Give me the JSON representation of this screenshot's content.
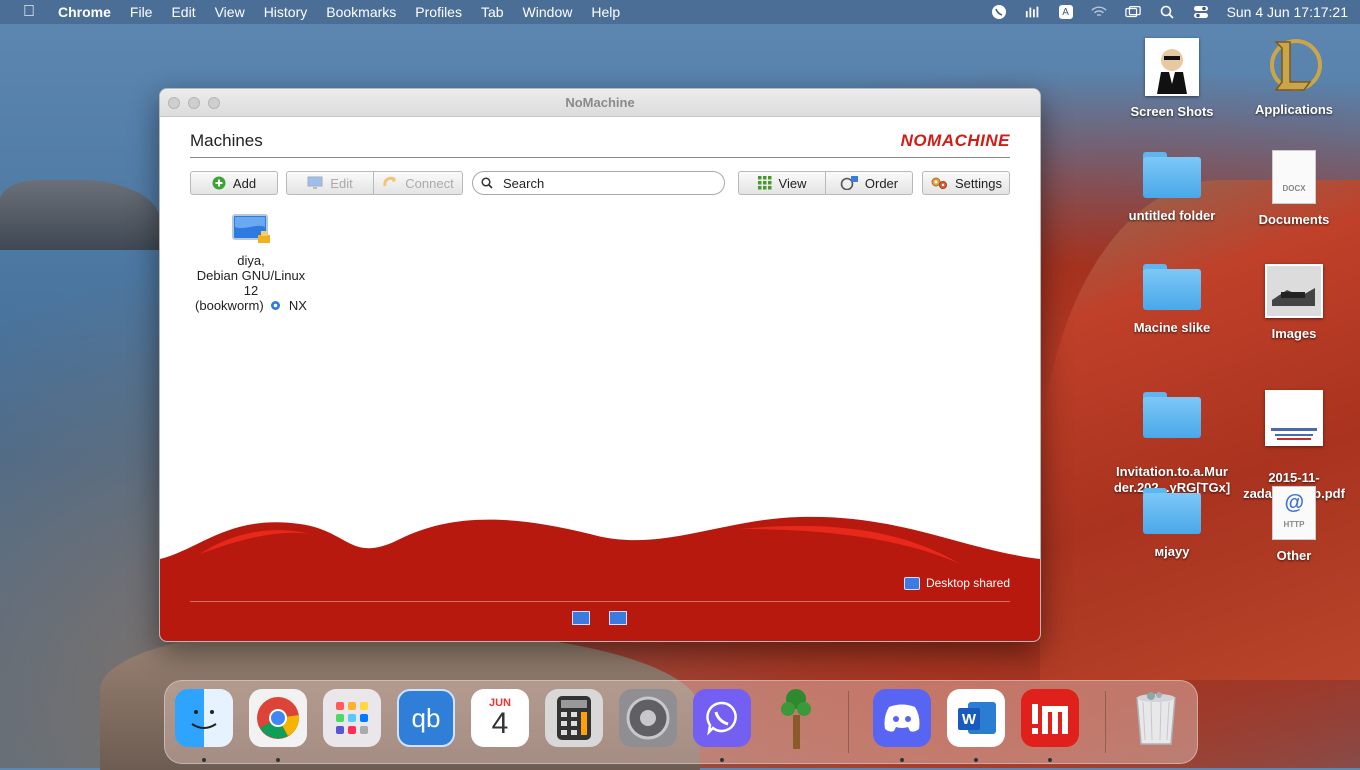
{
  "menubar": {
    "apple_icon": "apple-icon",
    "items": [
      "Chrome",
      "File",
      "Edit",
      "View",
      "History",
      "Bookmarks",
      "Profiles",
      "Tab",
      "Window",
      "Help"
    ],
    "clock": "Sun 4 Jun  17:17:21",
    "input_source": "A"
  },
  "window": {
    "title": "NoMachine",
    "section_title": "Machines",
    "logo_text": "NOMACHINE",
    "toolbar": {
      "add": "Add",
      "edit": "Edit",
      "connect": "Connect",
      "search_placeholder": "Search",
      "view": "View",
      "order": "Order",
      "settings": "Settings"
    },
    "machines": [
      {
        "line1": "diya,",
        "line2": "Debian GNU/Linux 12",
        "line3": "(bookworm)",
        "protocol": "NX"
      }
    ],
    "footer": {
      "desktop_shared": "Desktop shared"
    }
  },
  "desktop_icons": [
    {
      "label": "Screen Shots",
      "icon": "tuxedo-portrait-icon"
    },
    {
      "label": "Applications",
      "icon": "league-logo-icon"
    },
    {
      "label": "untitled folder",
      "icon": "folder-icon"
    },
    {
      "label": "Documents",
      "icon": "docx-file-icon",
      "badge": "DOCX"
    },
    {
      "label": "Macine slike",
      "icon": "folder-icon"
    },
    {
      "label": "Images",
      "icon": "image-stack-icon"
    },
    {
      "label": "Invitation.to.a.Mur\nder.202...yRG[TGx]",
      "icon": "folder-icon"
    },
    {
      "label": "2015-11-\nzadar_group.pdf",
      "icon": "pdf-thumbnail-icon"
    },
    {
      "label": "мјауу",
      "icon": "folder-icon"
    },
    {
      "label": "Other",
      "icon": "http-file-icon",
      "badge": "HTTP"
    }
  ],
  "dock": {
    "apps": [
      "Finder",
      "Chrome",
      "Launchpad",
      "qBittorrent",
      "Calendar",
      "Calculator",
      "System Preferences",
      "Viber",
      "Terraria",
      "Discord",
      "Word",
      "NoMachine",
      "Trash"
    ],
    "calendar_month": "JUN",
    "calendar_day": "4",
    "qb_label": "qb"
  },
  "colors": {
    "nomachine_red": "#d01d17",
    "footer_red": "#b8190f",
    "folder_blue": "#5fb5ee"
  }
}
